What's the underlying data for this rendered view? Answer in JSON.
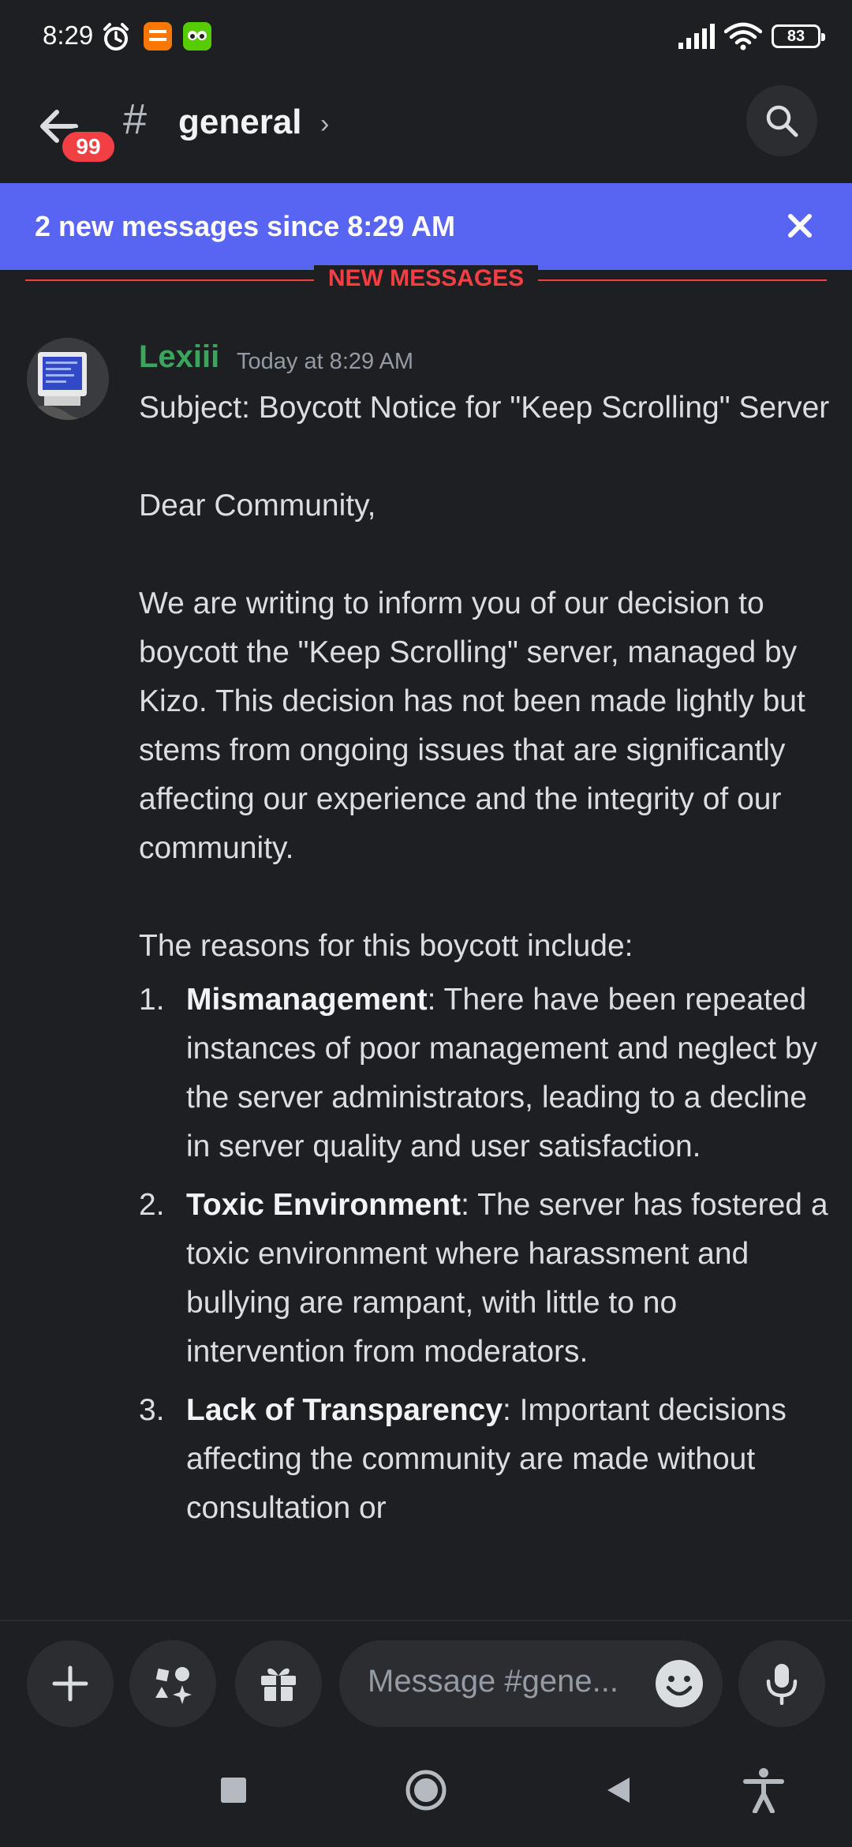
{
  "status_bar": {
    "time": "8:29",
    "battery": "83"
  },
  "header": {
    "badge": "99",
    "hash": "#",
    "channel": "general",
    "chevron": "›"
  },
  "new_messages_bar": {
    "text": "2 new messages since 8:29 AM"
  },
  "divider": {
    "label": "NEW MESSAGES"
  },
  "message": {
    "author": "Lexiii",
    "timestamp": "Today at 8:29 AM",
    "author_color": "#3ba55c",
    "subject": "Subject: Boycott Notice for \"Keep Scrolling\" Server",
    "greeting": "Dear Community,",
    "intro": "We are writing to inform you of our decision to boycott the \"Keep Scrolling\" server, managed by Kizo. This decision has not been made lightly but stems from ongoing issues that are significantly affecting our experience and the integrity of our community.",
    "reasons_heading": "The reasons for this boycott include:",
    "reasons": [
      {
        "num": "1.",
        "title": "Mismanagement",
        "text": ": There have been repeated instances of poor management and neglect by the server administrators, leading to a decline in server quality and user satisfaction."
      },
      {
        "num": "2.",
        "title": "Toxic Environment",
        "text": ": The server has fostered a toxic environment where harassment and bullying are rampant, with little to no intervention from moderators."
      },
      {
        "num": "3.",
        "title": "Lack of Transparency",
        "text": ": Important decisions affecting the community are made without consultation or"
      }
    ]
  },
  "input_bar": {
    "placeholder": "Message #gene..."
  },
  "colors": {
    "accent": "#5865f2",
    "alert": "#f23f43",
    "background": "#1e1f22"
  }
}
